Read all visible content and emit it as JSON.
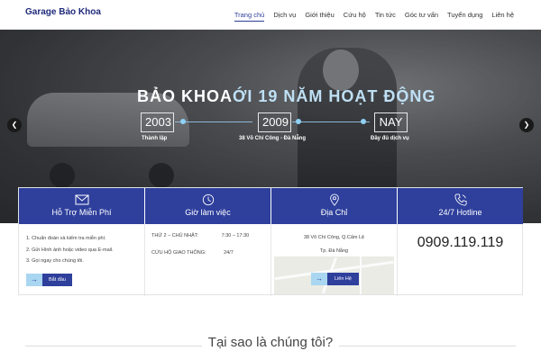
{
  "brand": "Garage Bảo Khoa",
  "nav": [
    {
      "label": "Trang chủ",
      "active": true
    },
    {
      "label": "Dịch vụ"
    },
    {
      "label": "Giới thiệu"
    },
    {
      "label": "Cứu hộ"
    },
    {
      "label": "Tin tức"
    },
    {
      "label": "Góc tư vấn"
    },
    {
      "label": "Tuyển dụng"
    },
    {
      "label": "Liên hệ"
    }
  ],
  "hero": {
    "title_main": "BẢO KHOA",
    "title_accent": "ỚI 19 NĂM HOẠT ĐỘNG",
    "prev_icon": "chevron-left-icon",
    "next_icon": "chevron-right-icon",
    "timeline": [
      {
        "year": "2003",
        "caption": "Thành lập"
      },
      {
        "year": "2009",
        "caption": "38 Võ Chí Công - Đà Nẵng"
      },
      {
        "year": "NAY",
        "caption": "Đầy đủ dịch vụ"
      }
    ]
  },
  "features": {
    "support": {
      "icon": "envelope-icon",
      "title": "Hỗ Trợ Miễn Phí",
      "items": [
        "1.  Chuẩn đoán và kiểm tra miễn phí.",
        "2.  Gửi Hình ảnh hoặc video qua E-mail.",
        "3.  Gọi ngay cho chúng tôi."
      ],
      "button": "Bắt đầu"
    },
    "hours": {
      "icon": "clock-icon",
      "title": "Giờ làm việc",
      "rows": [
        {
          "label": "THỨ 2 – CHỦ NHẬT:",
          "value": "7:30 – 17:30"
        },
        {
          "label": "CỨU HỘ GIAO THÔNG:",
          "value": "24/7"
        }
      ]
    },
    "address": {
      "icon": "map-pin-icon",
      "title": "Địa Chỉ",
      "line1": "38 Võ Chí Công, Q.Cẩm Lệ",
      "line2": "Tp. Đà Nẵng",
      "button": "Liên Hệ"
    },
    "hotline": {
      "icon": "phone-icon",
      "title": "24/7 Hotline",
      "number": "0909.119.119"
    }
  },
  "why_title": "Tại sao là chúng tôi?",
  "colors": {
    "primary": "#2e3f9c",
    "accent_light": "#a9d6f0"
  }
}
